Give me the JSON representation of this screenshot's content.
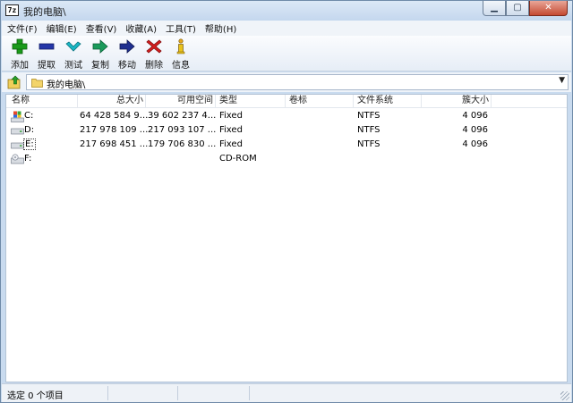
{
  "window": {
    "title": "我的电脑\\",
    "app_icon_text": "7z"
  },
  "menu": [
    "文件(F)",
    "编辑(E)",
    "查看(V)",
    "收藏(A)",
    "工具(T)",
    "帮助(H)"
  ],
  "toolbar": {
    "add": "添加",
    "extract": "提取",
    "test": "测试",
    "copy": "复制",
    "move": "移动",
    "delete": "删除",
    "info": "信息"
  },
  "address": {
    "path": "我的电脑\\"
  },
  "columns": {
    "name": "名称",
    "total_size": "总大小",
    "free_space": "可用空间",
    "type": "类型",
    "label": "卷标",
    "file_system": "文件系统",
    "cluster_size": "簇大小"
  },
  "drives": [
    {
      "name": "C:",
      "total": "64 428 584 9...",
      "free": "39 602 237 4...",
      "type": "Fixed",
      "fs": "NTFS",
      "cluster": "4 096"
    },
    {
      "name": "D:",
      "total": "217 978 109 ...",
      "free": "217 093 107 ...",
      "type": "Fixed",
      "fs": "NTFS",
      "cluster": "4 096"
    },
    {
      "name": "E:",
      "total": "217 698 451 ...",
      "free": "179 706 830 ...",
      "type": "Fixed",
      "fs": "NTFS",
      "cluster": "4 096"
    },
    {
      "name": "F:",
      "total": "",
      "free": "",
      "type": "CD-ROM",
      "fs": "",
      "cluster": ""
    }
  ],
  "status": {
    "selected": "选定 0 个项目"
  }
}
